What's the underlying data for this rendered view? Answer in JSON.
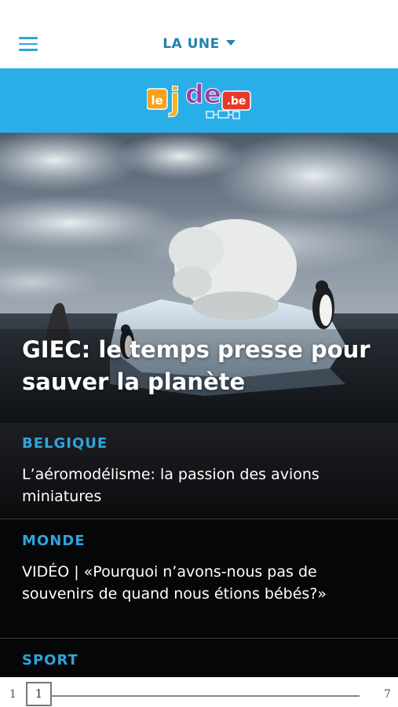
{
  "header": {
    "menu_icon": "hamburger-menu-icon",
    "section_label": "LA UNE",
    "section_caret_icon": "caret-down-icon"
  },
  "brand": {
    "logo_text_le": "le",
    "logo_text_j": "j",
    "logo_text_de": "de",
    "logo_text_be": ".be",
    "logo_devices_icon": "devices-icon",
    "band_color": "#2aaee8"
  },
  "hero": {
    "title": "GIEC: le temps presse pour sauver la planète"
  },
  "articles": [
    {
      "category": "BELGIQUE",
      "headline": "L’aéromodélisme: la passion des avions miniatures"
    },
    {
      "category": "MONDE",
      "headline": "VIDÉO | «Pourquoi n’avons-nous pas de souvenirs de quand nous étions bébés?»"
    },
    {
      "category": "SPORT",
      "headline": ""
    }
  ],
  "pager": {
    "first": "1",
    "current": "1",
    "last": "7"
  },
  "colors": {
    "accent": "#2fa4dc",
    "section_label": "#2580ad",
    "news_bg": "#050608"
  }
}
